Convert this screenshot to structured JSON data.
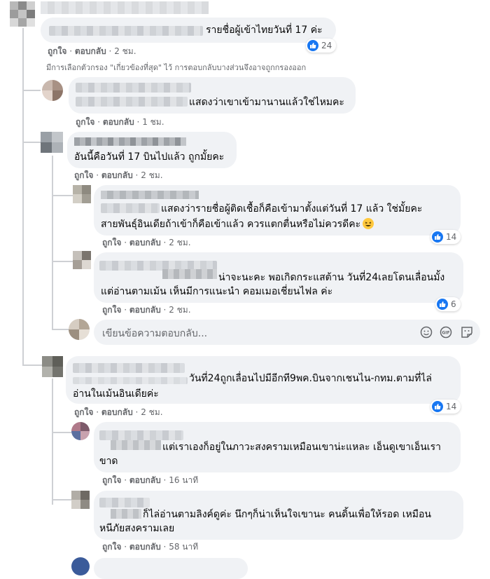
{
  "comments": [
    {
      "text": "รายชื่อผู้เข้าไทยวันที่ 17 ค่ะ",
      "like_label": "ถูกใจ",
      "reply_label": "ตอบกลับ",
      "time": "2 ชม.",
      "reactions": "24"
    },
    {
      "text": "แสดงว่าเขาเข้ามานานแล้วใช่ไหมคะ",
      "like_label": "ถูกใจ",
      "reply_label": "ตอบกลับ",
      "time": "1 ชม."
    },
    {
      "text": "อันนี้คือวันที่ 17 บินไปแล้ว ถูกมั้ยคะ",
      "like_label": "ถูกใจ",
      "reply_label": "ตอบกลับ",
      "time": "2 ชม."
    },
    {
      "line1": "แสดงว่ารายชื่อผู้ติดเชื้อก็คือเข้ามาตั้งแต่วันที่ 17 แล้ว ใช่มั้ยคะ",
      "line2": "สายพันธุ์อินเดียถ้าเข้าก็คือเข้าแล้ว ควรแตกตื่นหรือไม่ควรดีคะ",
      "like_label": "ถูกใจ",
      "reply_label": "ตอบกลับ",
      "time": "2 ชม.",
      "reactions": "14"
    },
    {
      "line1": "น่าจะนะคะ พอเกิดกระแสต้าน วันที่24เลยโดนเลื่อนมั้ง",
      "line2": "แต่อ่านตามเม้น เห็นมีการแนะนำ คอมเมอเชี่ยนไฟล ค่ะ",
      "like_label": "ถูกใจ",
      "reply_label": "ตอบกลับ",
      "time": "2 ชม.",
      "reactions": "6"
    },
    {
      "line1": "วันที่24ถูกเลื่อนไปมีอีกที9พค.บินจากเชนไน-กทม.ตามที่ไล่",
      "line2": "อ่านในเม้นอินเดียค่ะ",
      "like_label": "ถูกใจ",
      "reply_label": "ตอบกลับ",
      "time": "2 ชม.",
      "reactions": "14"
    },
    {
      "line1": "แต่เราเองก็อยู่ในภาวะสงครามเหมือนเขาน่ะแหละ เอ็นดูเขาเอ็นเรา",
      "line2": "ขาด",
      "like_label": "ถูกใจ",
      "reply_label": "ตอบกลับ",
      "time": "16 นาที"
    },
    {
      "line1": "ก็ไล่อ่านตามลิงค์ดูค่ะ นึกๆก็น่าเห็นใจเขานะ คนดิ้นเพื่อให้รอด เหมือน",
      "line2": "หนีภัยสงครามเลย",
      "like_label": "ถูกใจ",
      "reply_label": "ตอบกลับ",
      "time": "58 นาที"
    }
  ],
  "filter_note": "มีการเลือกตัวกรอง \"เกี่ยวข้องที่สุด\" ไว้ การตอบกลับบางส่วนจึงอาจถูกกรองออก",
  "reply_box": {
    "placeholder": "เขียนข้อความตอบกลับ...",
    "icons": [
      "emoji-icon",
      "gif-icon",
      "sticker-icon"
    ]
  },
  "colors": {
    "bubble": "#f0f2f5",
    "meta_text": "#65676b",
    "like_blue": "#1877f2"
  }
}
